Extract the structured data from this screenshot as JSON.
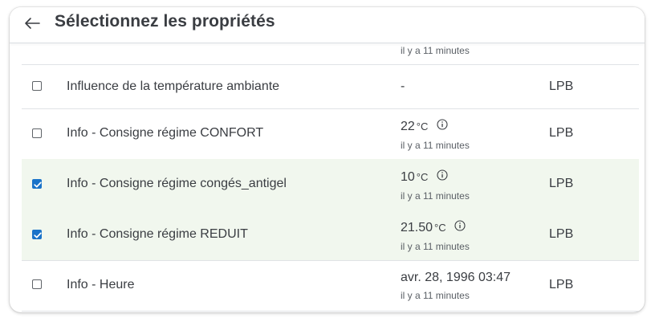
{
  "header": {
    "title": "Sélectionnez les propriétés",
    "back_icon": "arrow-left-icon"
  },
  "rows": [
    {
      "name": "",
      "value": "",
      "unit": "",
      "updated": "il y a 11 minutes",
      "source": "",
      "checked": false
    },
    {
      "name": "Influence de la température ambiante",
      "value": "-",
      "unit": "",
      "updated": "",
      "source": "LPB",
      "checked": false
    },
    {
      "name": "Info - Consigne régime CONFORT",
      "value": "22",
      "unit": "°C",
      "updated": "il y a 11 minutes",
      "source": "LPB",
      "checked": false,
      "info_icon": "info-circle-icon"
    },
    {
      "name": "Info - Consigne régime congés_antigel",
      "value": "10",
      "unit": "°C",
      "updated": "il y a 11 minutes",
      "source": "LPB",
      "checked": true,
      "info_icon": "info-circle-icon"
    },
    {
      "name": "Info - Consigne régime REDUIT",
      "value": "21.50",
      "unit": "°C",
      "updated": "il y a 11 minutes",
      "source": "LPB",
      "checked": true,
      "info_icon": "info-circle-icon"
    },
    {
      "name": "Info - Heure",
      "value": "avr. 28, 1996 03:47",
      "unit": "",
      "updated": "il y a 11 minutes",
      "source": "LPB",
      "checked": false
    }
  ],
  "colors": {
    "checked_row_bg": "#f1f7ee",
    "checkbox_checked": "#1a73c9",
    "text": "#3a3d42",
    "divider": "#e0e3e6"
  }
}
